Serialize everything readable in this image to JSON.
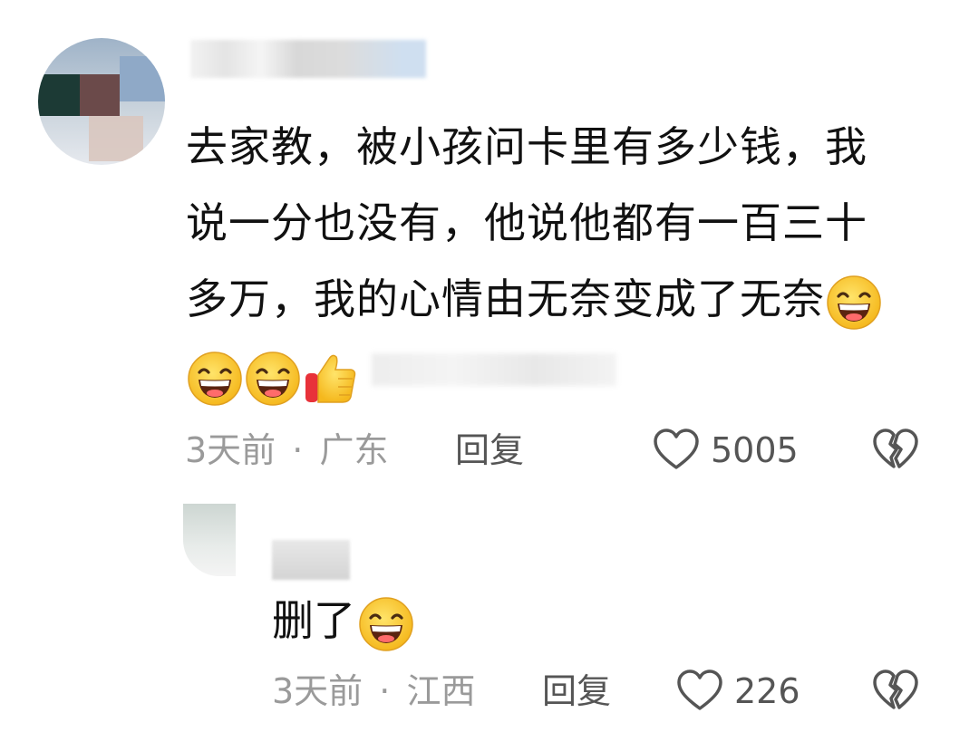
{
  "comments": [
    {
      "text_lines": [
        "去家教，被小孩问卡里有多少钱，我",
        "说一分也没有，他说他都有一百三十",
        "多万，我的心情由无奈变成了无奈"
      ],
      "meta_time": "3天前",
      "meta_sep": "·",
      "meta_location": "广东",
      "reply_label": "回复",
      "like_count": "5005",
      "emojis": [
        "grin-emoji",
        "grin-emoji",
        "grin-emoji",
        "thumbs-up-emoji"
      ]
    },
    {
      "text": "删了",
      "meta_time": "3天前",
      "meta_sep": "·",
      "meta_location": "江西",
      "reply_label": "回复",
      "like_count": "226",
      "emojis": [
        "grin-emoji"
      ]
    }
  ],
  "icons": {
    "like": "heart-outline-icon",
    "dislike": "broken-heart-icon"
  },
  "colors": {
    "text": "#111111",
    "meta": "#9a9a9a",
    "action": "#555555",
    "emoji_face": "#fbd24a"
  }
}
